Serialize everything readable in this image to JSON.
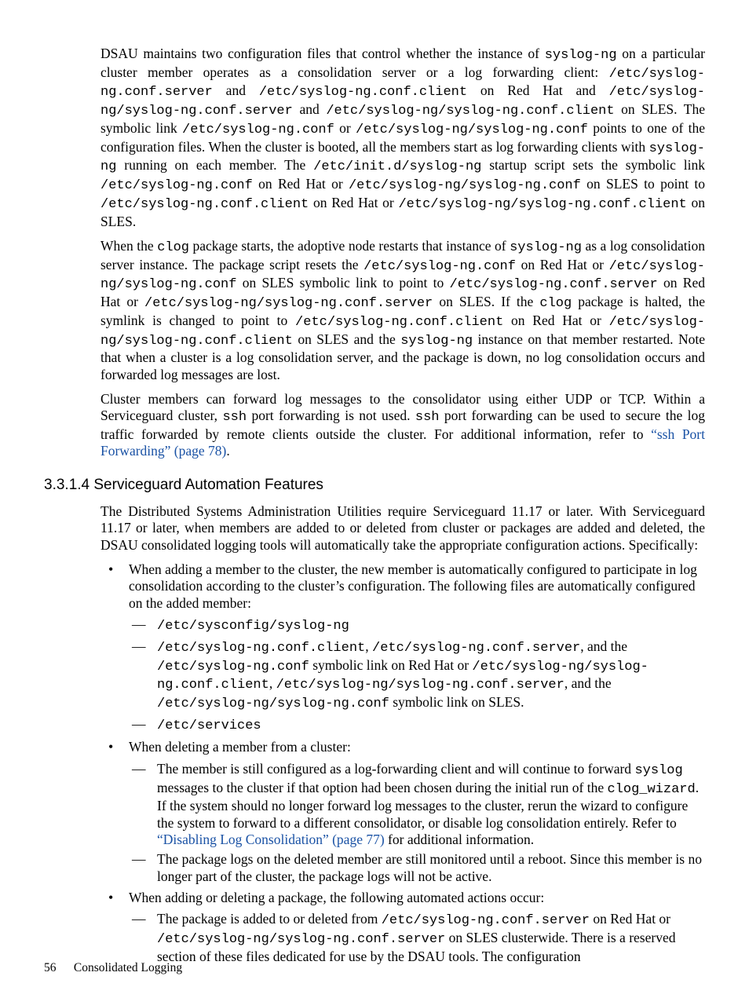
{
  "para1_seg1": "DSAU maintains two configuration files that control whether the instance of ",
  "c_syslogng": "syslog-ng",
  "para1_seg2": " on a particular cluster member operates as a consolidation server or a log forwarding client: ",
  "c_conf_server": "/etc/syslog-ng.conf.server",
  "para1_and1": " and ",
  "c_conf_client": "/etc/syslog-ng.conf.client",
  "para1_rh_and": " on Red Hat and ",
  "c_sles_server": "/etc/syslog-ng/syslog-ng.conf.server",
  "para1_and2": " and ",
  "c_sles_client": "/etc/syslog-ng/syslog-ng.conf.client",
  "para1_sles_link": " on SLES. The symbolic link ",
  "c_etc_prefix": "/etc/",
  "c_syslogng_conf_bare": "syslog-ng.conf",
  "para1_or": " or ",
  "c_sles_conf": "/etc/syslog-ng/syslog-ng.conf",
  "para1_points": " points to one of the configuration files. When the cluster is booted, all the members start as log forwarding clients with ",
  "para1_running": " running on each member. The ",
  "c_initd": "/etc/init.d/syslog-ng",
  "para1_startup": " startup script sets the symbolic link ",
  "c_etc_conf": "/etc/syslog-ng.conf",
  "para1_rh_or": " on Red Hat or ",
  "para1_sles_to": " on SLES to point to ",
  "para1_rh_or2": " on Red Hat or ",
  "para1_sles_end": " on SLES.",
  "para2_seg1": "When the ",
  "c_clog": "clog",
  "para2_seg2": " package starts, the adoptive node restarts that instance of ",
  "para2_seg3": " as a log consolidation server instance. The package script resets the ",
  "para2_rh_or": " on Red Hat or ",
  "para2_sles_link": " on SLES symbolic link to point to ",
  "para2_rh_or2": " on Red Hat or ",
  "para2_sles_if": " on SLES. If the ",
  "para2_halted": " package is halted, the symlink is changed to point to ",
  "para2_rh_or3": " on Red Hat or ",
  "para2_sles_and": " on SLES and the ",
  "para2_instance": " instance on that member restarted. Note that when a cluster is a log consolidation server, and the package is down, no log consolidation occurs and forwarded log messages are lost.",
  "para3_seg1": "Cluster members can forward log messages to the consolidator using either UDP or TCP. Within a Serviceguard cluster, ",
  "c_ssh": "ssh",
  "para3_seg2": " port forwarding is not used. ",
  "para3_seg3": " port forwarding can be used to secure the log traffic forwarded by remote clients outside the cluster. For additional information, refer to ",
  "link_ssh": "“ssh Port Forwarding” (page 78)",
  "para3_end": ".",
  "heading": "3.3.1.4 Serviceguard Automation Features",
  "para4": "The Distributed Systems Administration Utilities require Serviceguard 11.17 or later. With Serviceguard 11.17 or later, when members are added to or deleted from cluster or packages are added and deleted, the DSAU consolidated logging tools will automatically take the appropriate configuration actions. Specifically:",
  "b1_text": "When adding a member to the cluster, the new member is automatically configured to participate in log consolidation according to the cluster’s configuration. The following files are automatically configured on the added member:",
  "b1_d1": "/etc/sysconfig/syslog-ng",
  "b1_d2_c1": "/etc/syslog-ng.conf.client",
  "b1_d2_s1": ", ",
  "b1_d2_c2": "/etc/syslog-ng.conf.server",
  "b1_d2_s2": ", and the ",
  "b1_d2_c3": "/etc/",
  "b1_d2_c3b": "syslog-ng.conf",
  "b1_d2_s3": " symbolic link on Red Hat or ",
  "b1_d2_c4": "/etc/syslog-ng/",
  "b1_d2_c4b": "syslog-ng.conf.client",
  "b1_d2_s4": ", ",
  "b1_d2_c5": "/etc/syslog-ng/syslog-ng.conf.server",
  "b1_d2_s5": ", and the ",
  "b1_d2_c6": "/etc/syslog-ng/syslog-ng.conf",
  "b1_d2_s6": " symbolic link on SLES.",
  "b1_d3": "/etc/services",
  "b2_text": "When deleting a member from a cluster:",
  "b2_d1_s1": "The member is still configured as a log-forwarding client and will continue to forward ",
  "c_syslog": "syslog",
  "b2_d1_s2": " messages to the cluster if that option had been chosen during the initial run of the ",
  "c_clog_wizard": "clog_wizard",
  "b2_d1_s3": ". If the system should no longer forward log messages to the cluster, rerun the wizard to configure the system to forward to a different consolidator, or disable log consolidation entirely. Refer to ",
  "link_disable": "“Disabling Log Consolidation” (page 77)",
  "b2_d1_s4": " for additional information.",
  "b2_d2": "The package logs on the deleted member are still monitored until a reboot. Since this member is no longer part of the cluster, the package logs will not be active.",
  "b3_text": "When adding or deleting a package, the following automated actions occur:",
  "b3_d1_s1": "The package is added to or deleted from ",
  "b3_d1_s2": " on Red Hat or ",
  "b3_d1_s3": " on SLES clusterwide. There is a reserved section of these files dedicated for use by the DSAU tools. The configuration",
  "footer_page": "56",
  "footer_title": "Consolidated Logging"
}
